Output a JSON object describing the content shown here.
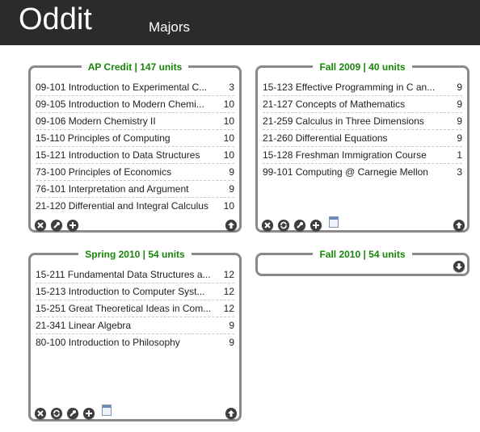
{
  "header": {
    "logo": "Oddit",
    "nav_majors": "Majors"
  },
  "panels": [
    {
      "title": "AP Credit | 147 units",
      "courses": [
        {
          "name": "09-101 Introduction to Experimental C...",
          "units": "3"
        },
        {
          "name": "09-105 Introduction to Modern Chemi...",
          "units": "10"
        },
        {
          "name": "09-106 Modern Chemistry II",
          "units": "10"
        },
        {
          "name": "15-110 Principles of Computing",
          "units": "10"
        },
        {
          "name": "15-121 Introduction to Data Structures",
          "units": "10"
        },
        {
          "name": "73-100 Principles of Economics",
          "units": "9"
        },
        {
          "name": "76-101 Interpretation and Argument",
          "units": "9"
        },
        {
          "name": "21-120 Differential and Integral Calculus",
          "units": "10"
        }
      ],
      "actions": [
        "close-icon",
        "wrench-icon",
        "add-icon"
      ],
      "corner_action": "collapse-up-icon"
    },
    {
      "title": "Fall 2009 | 40 units",
      "courses": [
        {
          "name": "15-123 Effective Programming in C an...",
          "units": "9"
        },
        {
          "name": "21-127 Concepts of Mathematics",
          "units": "9"
        },
        {
          "name": "21-259 Calculus in Three Dimensions",
          "units": "9"
        },
        {
          "name": "21-260 Differential Equations",
          "units": "9"
        },
        {
          "name": "15-128 Freshman Immigration Course",
          "units": "1"
        },
        {
          "name": "99-101 Computing @ Carnegie Mellon",
          "units": "3"
        }
      ],
      "actions": [
        "close-icon",
        "refresh-icon",
        "wrench-icon",
        "add-icon",
        "calendar-icon"
      ],
      "corner_action": "collapse-up-icon"
    },
    {
      "title": "Spring 2010 | 54 units",
      "courses": [
        {
          "name": "15-211 Fundamental Data Structures a...",
          "units": "12"
        },
        {
          "name": "15-213 Introduction to Computer Syst...",
          "units": "12"
        },
        {
          "name": "15-251 Great Theoretical Ideas in Com...",
          "units": "12"
        },
        {
          "name": "21-341 Linear Algebra",
          "units": "9"
        },
        {
          "name": "80-100 Introduction to Philosophy",
          "units": "9"
        }
      ],
      "actions": [
        "close-icon",
        "refresh-icon",
        "wrench-icon",
        "add-icon",
        "calendar-icon"
      ],
      "corner_action": "collapse-up-icon"
    },
    {
      "title": "Fall 2010 | 54 units",
      "courses": [],
      "actions": [],
      "corner_action": "expand-down-icon"
    }
  ],
  "colors": {
    "topbar": "#2b2b2b",
    "title_green": "#18860a",
    "panel_border": "#8a8a8a"
  }
}
